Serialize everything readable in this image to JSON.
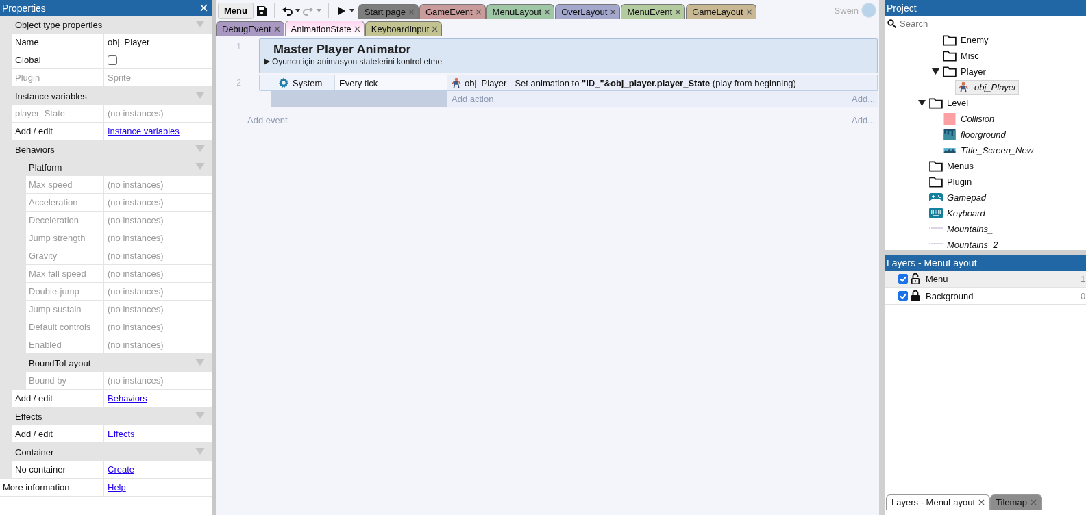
{
  "properties": {
    "title": "Properties",
    "sections": [
      {
        "title": "Object type properties",
        "expanded": true,
        "rows": [
          {
            "kind": "text",
            "label": "Name",
            "value": "obj_Player",
            "disabled": false
          },
          {
            "kind": "checkbox",
            "label": "Global",
            "checked": false,
            "disabled": false
          },
          {
            "kind": "text",
            "label": "Plugin",
            "value": "Sprite",
            "disabled": true
          }
        ]
      },
      {
        "title": "Instance variables",
        "expanded": true,
        "rows": [
          {
            "kind": "text",
            "label": "player_State",
            "value": "(no instances)",
            "disabled": true
          },
          {
            "kind": "link",
            "label": "Add / edit",
            "value": "Instance variables",
            "disabled": false
          }
        ]
      },
      {
        "title": "Behaviors",
        "expanded": true,
        "rows": [
          {
            "kind": "subsection",
            "title": "Platform",
            "expanded": true,
            "rows": [
              {
                "kind": "text",
                "label": "Max speed",
                "value": "(no instances)",
                "disabled": true
              },
              {
                "kind": "text",
                "label": "Acceleration",
                "value": "(no instances)",
                "disabled": true
              },
              {
                "kind": "text",
                "label": "Deceleration",
                "value": "(no instances)",
                "disabled": true
              },
              {
                "kind": "text",
                "label": "Jump strength",
                "value": "(no instances)",
                "disabled": true
              },
              {
                "kind": "text",
                "label": "Gravity",
                "value": "(no instances)",
                "disabled": true
              },
              {
                "kind": "text",
                "label": "Max fall speed",
                "value": "(no instances)",
                "disabled": true
              },
              {
                "kind": "text",
                "label": "Double-jump",
                "value": "(no instances)",
                "disabled": true
              },
              {
                "kind": "text",
                "label": "Jump sustain",
                "value": "(no instances)",
                "disabled": true
              },
              {
                "kind": "text",
                "label": "Default controls",
                "value": "(no instances)",
                "disabled": true
              },
              {
                "kind": "text",
                "label": "Enabled",
                "value": "(no instances)",
                "disabled": true
              }
            ]
          },
          {
            "kind": "subsection",
            "title": "BoundToLayout",
            "expanded": true,
            "rows": [
              {
                "kind": "text",
                "label": "Bound by",
                "value": "(no instances)",
                "disabled": true
              }
            ]
          },
          {
            "kind": "link",
            "label": "Add / edit",
            "value": "Behaviors",
            "disabled": false
          }
        ]
      },
      {
        "title": "Effects",
        "expanded": true,
        "rows": [
          {
            "kind": "link",
            "label": "Add / edit",
            "value": "Effects",
            "disabled": false
          }
        ]
      },
      {
        "title": "Container",
        "expanded": true,
        "rows": [
          {
            "kind": "link",
            "label": "No container",
            "value": "Create",
            "disabled": false
          }
        ]
      }
    ],
    "footer": {
      "kind": "link",
      "label": "More information",
      "value": "Help",
      "disabled": false
    }
  },
  "toolbar": {
    "menu": "Menu",
    "redo_disabled": true
  },
  "tabs": [
    {
      "label": "Start page",
      "color": "#7d7d7d",
      "selected": false
    },
    {
      "label": "GameEvent",
      "color": "#c99b9b",
      "selected": false
    },
    {
      "label": "MenuLayout",
      "color": "#9fc7a6",
      "selected": false
    },
    {
      "label": "OverLayout",
      "color": "#a3a7cb",
      "selected": false
    },
    {
      "label": "MenuEvent",
      "color": "#b3cc9f",
      "selected": false
    },
    {
      "label": "GameLayout",
      "color": "#c9b894",
      "selected": false
    },
    {
      "label": "DebugEvent",
      "color": "#a999c2",
      "selected": false
    },
    {
      "label": "AnimationState",
      "color": "#ffd6f0",
      "selected": true
    },
    {
      "label": "KeyboardInput",
      "color": "#c3c392",
      "selected": false
    }
  ],
  "user": {
    "name": "Swein"
  },
  "event_sheet": {
    "rows": [
      {
        "kind": "group",
        "number": "1",
        "title": "Master Player Animator",
        "description": "Oyuncu için animasyon statelerini kontrol etme"
      },
      {
        "kind": "event",
        "number": "2",
        "condition": {
          "kind": "system",
          "object": "System",
          "text": "Every tick"
        },
        "action": {
          "kind": "sprite",
          "object": "obj_Player",
          "text": "Set animation to **\"ID_\"&obj_player.player_State** (play from beginning)"
        },
        "add_action": "Add action",
        "add_more": "Add..."
      }
    ],
    "add_event": "Add event",
    "add_more": "Add..."
  },
  "project": {
    "title": "Project",
    "search": {
      "placeholder": "Search"
    },
    "tree": [
      {
        "kind": "continuation",
        "children": [
          {
            "kind": "folder",
            "label": "Enemy",
            "selected": false
          },
          {
            "kind": "folder",
            "label": "Misc",
            "selected": false
          },
          {
            "kind": "folder",
            "label": "Player",
            "selected": false,
            "children": [
              {
                "kind": "sprite",
                "label": "obj_Player",
                "selected": true
              }
            ]
          }
        ]
      },
      {
        "kind": "folder",
        "label": "Level",
        "selected": false,
        "children": [
          {
            "kind": "solid",
            "label": "Collision",
            "selected": false
          },
          {
            "kind": "tiled",
            "label": "floorground",
            "selected": false
          },
          {
            "kind": "image",
            "label": "Title_Screen_New",
            "selected": false
          }
        ]
      },
      {
        "kind": "folder",
        "label": "Menus",
        "selected": false
      },
      {
        "kind": "folder",
        "label": "Plugin",
        "selected": false
      },
      {
        "kind": "gamepad",
        "label": "Gamepad",
        "selected": false
      },
      {
        "kind": "keyboard",
        "label": "Keyboard",
        "selected": false
      },
      {
        "kind": "line",
        "label": "Mountains_",
        "selected": false
      },
      {
        "kind": "line",
        "label": "Mountains_2",
        "selected": false
      }
    ]
  },
  "layers": {
    "title": "Layers - MenuLayout",
    "rows": [
      {
        "name": "Menu",
        "visible": true,
        "locked": false,
        "selected": true,
        "value": "1"
      },
      {
        "name": "Background",
        "visible": true,
        "locked": true,
        "selected": false,
        "value": "0"
      }
    ]
  },
  "bottom_tabs": [
    {
      "label": "Layers - MenuLayout",
      "selected": true
    },
    {
      "label": "Tilemap",
      "selected": false
    }
  ]
}
